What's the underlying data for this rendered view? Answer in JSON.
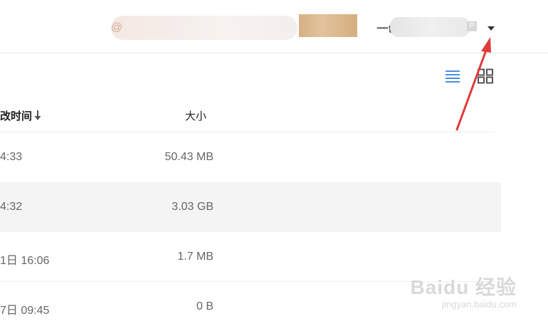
{
  "header": {
    "email_prefix": "@",
    "username_prefix": "一t",
    "vip_badge": "P"
  },
  "table": {
    "columns": {
      "time": "改时间",
      "size": "大小"
    },
    "rows": [
      {
        "time": "4:33",
        "size": "50.43 MB"
      },
      {
        "time": "4:32",
        "size": "3.03 GB"
      },
      {
        "time": "1日 16:06",
        "size": "1.7 MB"
      },
      {
        "time": "7日 09:45",
        "size": "0 B"
      }
    ]
  },
  "watermark": {
    "main": "Baidu 经验",
    "sub": "jingyan.baidu.com"
  },
  "colors": {
    "accent": "#4a90e2",
    "annotation": "#e03a3a",
    "stripe": "#f4f4f4"
  }
}
